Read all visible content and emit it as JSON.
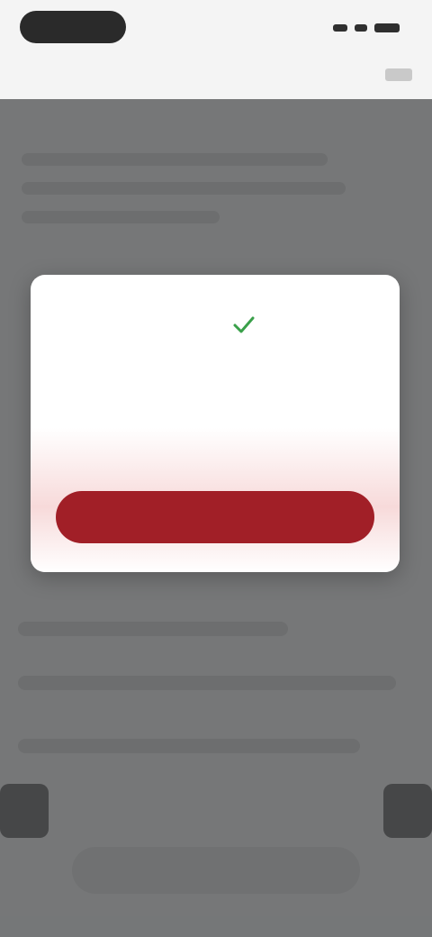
{
  "header": {
    "brand_logo": "brand-logo",
    "page_title": "",
    "status_icons": [
      "signal-icon",
      "wifi-icon",
      "battery-icon"
    ]
  },
  "dialog": {
    "icon": "check-icon",
    "icon_color": "#3aa04a",
    "message": "",
    "confirm_label": "",
    "confirm_color": "#a11f27"
  },
  "colors": {
    "overlay": "#46484a",
    "accent": "#a11f27"
  }
}
